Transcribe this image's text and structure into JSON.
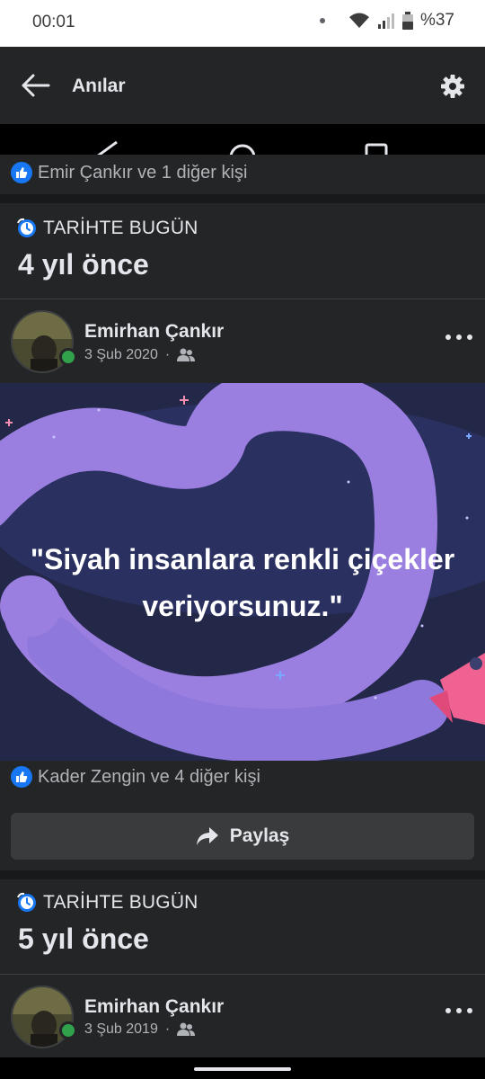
{
  "status_bar": {
    "time": "00:01",
    "battery": "%37"
  },
  "app_bar": {
    "title": "Anılar"
  },
  "feed": {
    "first_card": {
      "reactions": "Emir Çankır ve 1 diğer kişi"
    },
    "memory_1": {
      "label": "TARİHTE BUGÜN",
      "years": "4 yıl önce",
      "post": {
        "author": "Emirhan Çankır",
        "date": "3 Şub 2020",
        "separator": "·",
        "quote_line1": "\"Siyah insanlara renkli çiçekler",
        "quote_line2": "veriyorsunuz.\"",
        "reactions": "Kader Zengin ve 4 diğer kişi",
        "share_label": "Paylaş"
      }
    },
    "memory_2": {
      "label": "TARİHTE BUGÜN",
      "years": "5 yıl önce",
      "post": {
        "author": "Emirhan Çankır",
        "date": "3 Şub 2019",
        "separator": "·"
      }
    }
  },
  "colors": {
    "background": "#18191a",
    "card": "#242526",
    "accent": "#1877f2",
    "online": "#31a24c",
    "image_bg": "#232848",
    "blob": "#9b7fe0"
  },
  "icons": [
    "back-arrow-icon",
    "gear-icon",
    "like-icon",
    "clock-icon",
    "friends-icon",
    "more-icon",
    "share-arrow-icon"
  ]
}
